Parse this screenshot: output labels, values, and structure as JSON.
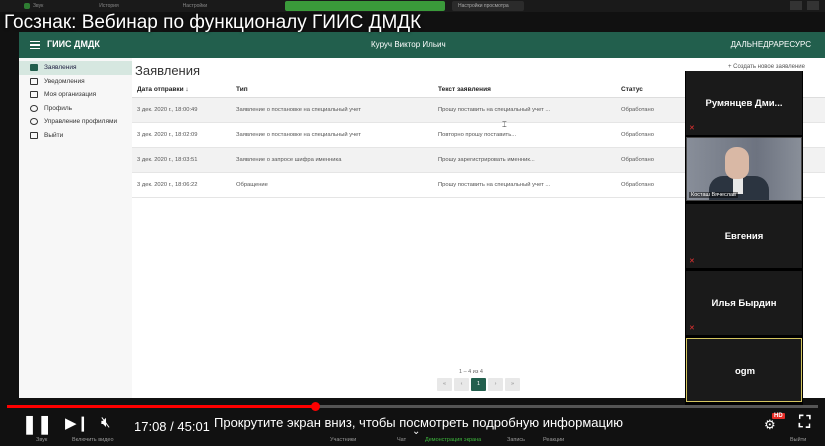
{
  "video": {
    "title": "Госзнак: Вебинар по функционалу ГИИС ДМДК",
    "time": "17:08 / 45:01",
    "scroll_hint": "Прокрутите экран вниз, чтобы посмотреть подробную информацию",
    "progress": 0.38,
    "hd_badge": "HD"
  },
  "zoom_toolbar": {
    "menu_1": "Звук",
    "menu_2": "История",
    "menu_3": "Настройки",
    "banner": "Вы просматриваете экран Говащь Арзи",
    "view_settings": "Настройки просмотра",
    "bottom": {
      "audio": "Звук",
      "video": "Включить видео",
      "participants": "Участники",
      "chat": "Чат",
      "share": "Демонстрация экрана",
      "record": "Запись",
      "reactions": "Реакции",
      "leave": "Выйти"
    }
  },
  "app": {
    "brand": "ГИИС ДМДК",
    "user": "Куруч Виктор Ильич",
    "org": "ДАЛЬНЕДРАРЕСУРС",
    "accent": "#225f4d"
  },
  "sidebar": {
    "items": [
      {
        "label": "Заявления",
        "icon": "checkbox-icon",
        "active": true
      },
      {
        "label": "Уведомления",
        "icon": "message-icon",
        "active": false
      },
      {
        "label": "Моя организация",
        "icon": "organization-icon",
        "active": false
      },
      {
        "label": "Профиль",
        "icon": "person-icon",
        "active": false
      },
      {
        "label": "Управление профилями",
        "icon": "people-icon",
        "active": false
      },
      {
        "label": "Выйти",
        "icon": "logout-icon",
        "active": false
      }
    ]
  },
  "main": {
    "title": "Заявления",
    "create_link": "+ Создать новое заявление",
    "columns": [
      "Дата отправки ↓",
      "Тип",
      "Текст заявления",
      "Статус"
    ],
    "rows": [
      {
        "date": "3 дек. 2020 г., 18:00:49",
        "type": "Заявление о постановке на специальный учет",
        "text": "Прошу поставить на специальный учет ...",
        "status": "Обработано"
      },
      {
        "date": "3 дек. 2020 г., 18:02:09",
        "type": "Заявление о постановке на специальный учет",
        "text": "Повторно прошу поставить...",
        "status": "Обработано"
      },
      {
        "date": "3 дек. 2020 г., 18:03:51",
        "type": "Заявление о запросе шифра именника",
        "text": "Прошу зарегистрировать именник...",
        "status": "Обработано"
      },
      {
        "date": "3 дек. 2020 г., 18:06:22",
        "type": "Обращение",
        "text": "Прошу поставить на специальный учет ...",
        "status": "Обработано"
      }
    ],
    "pagination_info": "1 – 4 из 4",
    "pager": [
      "«",
      "‹",
      "1",
      "›",
      "»"
    ]
  },
  "participants": [
    {
      "name": "Румянцев Дми...",
      "muted": true,
      "video": false
    },
    {
      "name": "Косташ Вячеслав",
      "muted": false,
      "video": true
    },
    {
      "name": "Евгения",
      "muted": true,
      "video": false
    },
    {
      "name": "Илья Бырдин",
      "muted": true,
      "video": false
    },
    {
      "name": "ogm",
      "muted": false,
      "video": false
    }
  ]
}
